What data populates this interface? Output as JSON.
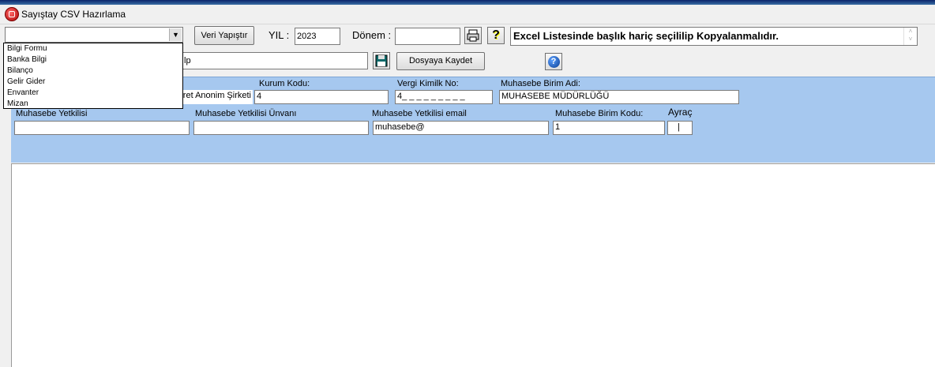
{
  "window": {
    "title": "Sayıştay CSV Hazırlama"
  },
  "toolbar": {
    "report_combo_value": "",
    "veri_yapistir_label": "Veri Yapıştır",
    "yil_label": "YIL :",
    "yil_value": "2023",
    "donem_label": "Dönem :",
    "donem_value": "",
    "message": "Excel Listesinde başlık hariç seçililip Kopyalanmalıdır."
  },
  "dropdown": {
    "options": [
      "Bilgi Formu",
      "Banka Bilgi",
      "Bilanço",
      "Gelir Gider",
      "Envanter",
      "Mizan"
    ]
  },
  "row2": {
    "path_value": "lp",
    "dosyaya_kaydet_label": "Dosyaya Kaydet"
  },
  "form": {
    "kurum_kodu_label": "Kurum Kodu:",
    "kurum_kodu_value": "4",
    "company_value": "ret Anonim Şirketi",
    "vergi_label": "Vergi Kimilk No:",
    "vergi_value": "4_ _ _ _ _ _ _ _ _",
    "birim_adi_label": "Muhasebe Birim Adi:",
    "birim_adi_value": "MUHASEBE MÜDÜRLÜĞÜ",
    "yetkilisi_label": "Muhasebe Yetkilisi",
    "yetkilisi_value": "",
    "unvani_label": "Muhasebe Yetkilisi Ünvanı",
    "unvani_value": "",
    "email_label": "Muhasebe Yetkilisi email",
    "email_value": "muhasebe@",
    "birim_kodu_label": "Muhasebe Birim Kodu:",
    "birim_kodu_value": "1",
    "ayrac_label": "Ayraç",
    "ayrac_value": "|"
  },
  "icons": {
    "app": "app-red-icon",
    "print": "printer-icon",
    "help": "question-mark-icon",
    "save": "save-disk-icon",
    "info": "help-circle-icon"
  }
}
